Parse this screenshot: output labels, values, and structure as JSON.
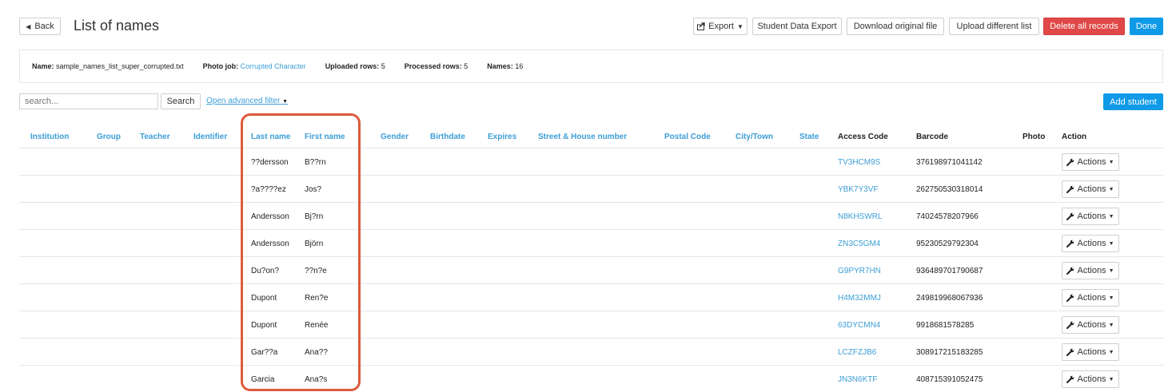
{
  "header": {
    "back_label": "Back",
    "title": "List of names",
    "export_label": "Export",
    "student_data_export": "Student Data Export",
    "download_original": "Download original file",
    "upload_different": "Upload different list",
    "delete_all": "Delete all records",
    "done": "Done"
  },
  "info": {
    "name_label": "Name:",
    "name_value": "sample_names_list_super_corrupted.txt",
    "photo_job_label": "Photo job:",
    "photo_job_value": "Corrupted Character",
    "uploaded_label": "Uploaded rows:",
    "uploaded_value": "5",
    "processed_label": "Processed rows:",
    "processed_value": "5",
    "names_label": "Names:",
    "names_value": "16"
  },
  "search": {
    "placeholder": "search...",
    "button": "Search",
    "advanced": "Open advanced filter",
    "add_student": "Add student"
  },
  "table": {
    "columns": {
      "institution": "Institution",
      "group": "Group",
      "teacher": "Teacher",
      "identifier": "Identifier",
      "last_name": "Last name",
      "first_name": "First name",
      "gender": "Gender",
      "birthdate": "Birthdate",
      "expires": "Expires",
      "street": "Street & House number",
      "postal": "Postal Code",
      "city": "City/Town",
      "state": "State",
      "access_code": "Access Code",
      "barcode": "Barcode",
      "photo": "Photo",
      "action": "Action"
    },
    "action_label": "Actions",
    "rows": [
      {
        "last": "??dersson",
        "first": "B??rn",
        "code": "TV3HCM9S",
        "barcode": "376198971041142"
      },
      {
        "last": "?a????ez",
        "first": "Jos?",
        "code": "YBK7Y3VF",
        "barcode": "262750530318014"
      },
      {
        "last": "Andersson",
        "first": "Bj?rn",
        "code": "N8KHSWRL",
        "barcode": "74024578207966"
      },
      {
        "last": "Andersson",
        "first": "Björn",
        "code": "ZN3C5GM4",
        "barcode": "95230529792304"
      },
      {
        "last": "Du?on?",
        "first": "??n?e",
        "code": "G9PYR7HN",
        "barcode": "936489701790687"
      },
      {
        "last": "Dupont",
        "first": "Ren?e",
        "code": "H4M32MMJ",
        "barcode": "249819968067936"
      },
      {
        "last": "Dupont",
        "first": "Renée",
        "code": "63DYCMN4",
        "barcode": "9918681578285"
      },
      {
        "last": "Gar??a",
        "first": "Ana??",
        "code": "LCZFZJB6",
        "barcode": "308917215183285"
      },
      {
        "last": "Garcia",
        "first": "Ana?s",
        "code": "JN3N6KTF",
        "barcode": "408715391052475"
      }
    ]
  }
}
